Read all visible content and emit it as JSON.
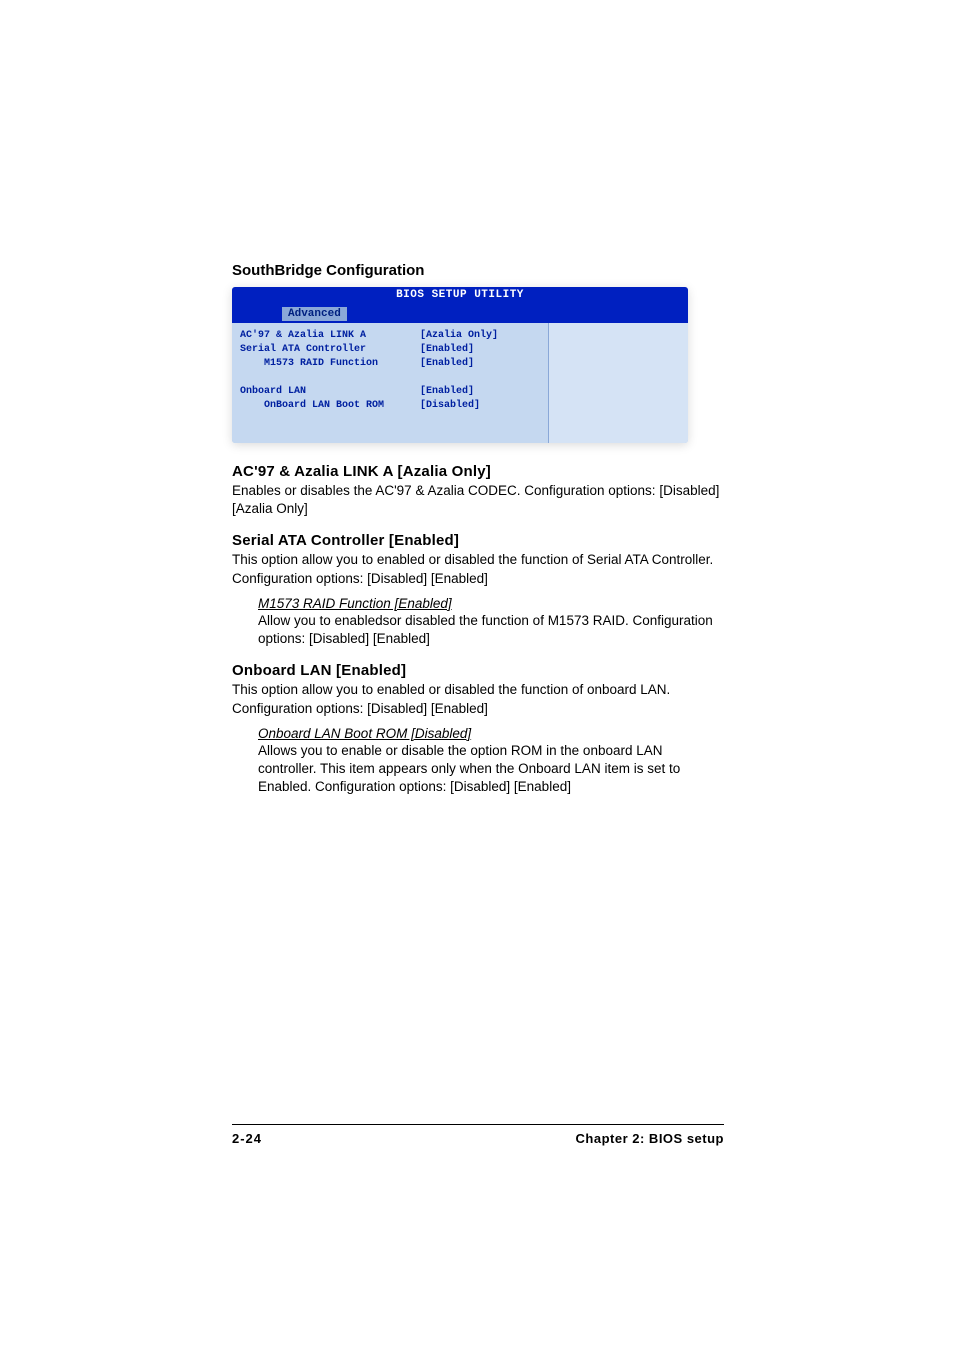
{
  "section_title": "SouthBridge Configuration",
  "bios": {
    "header": "BIOS SETUP UTILITY",
    "tab": "Advanced",
    "rows": [
      {
        "label": "AC'97 & Azalia LINK A",
        "value": "[Azalia Only]",
        "indent": false
      },
      {
        "label": "Serial ATA Controller",
        "value": "[Enabled]",
        "indent": false
      },
      {
        "label": "M1573 RAID Function",
        "value": "[Enabled]",
        "indent": true
      }
    ],
    "rows2": [
      {
        "label": "Onboard LAN",
        "value": "[Enabled]",
        "indent": false
      },
      {
        "label": "OnBoard LAN Boot ROM",
        "value": "[Disabled]",
        "indent": true
      }
    ]
  },
  "items": [
    {
      "heading": "AC'97 & Azalia LINK A [Azalia Only]",
      "desc": "Enables or disables the AC'97 & Azalia CODEC. Configuration options: [Disabled] [Azalia Only]"
    },
    {
      "heading": "Serial ATA Controller [Enabled]",
      "desc": "This option allow you to enabled or disabled the function of Serial ATA Controller. Configuration options: [Disabled] [Enabled]",
      "sub": {
        "title": "M1573 RAID Function [Enabled]",
        "desc": "Allow you to enabledsor disabled the function of M1573 RAID. Configuration options: [Disabled] [Enabled]"
      }
    },
    {
      "heading": "Onboard LAN [Enabled]",
      "desc": "This option allow you to enabled or disabled the function of onboard LAN. Configuration options: [Disabled] [Enabled]",
      "sub": {
        "title": "Onboard LAN Boot ROM [Disabled]",
        "desc": "Allows you to enable or disable the option ROM in the onboard LAN controller. This item appears only when the Onboard LAN item is set to Enabled. Configuration options: [Disabled] [Enabled]"
      }
    }
  ],
  "footer": {
    "page": "2-24",
    "chapter": "Chapter 2: BIOS setup"
  }
}
